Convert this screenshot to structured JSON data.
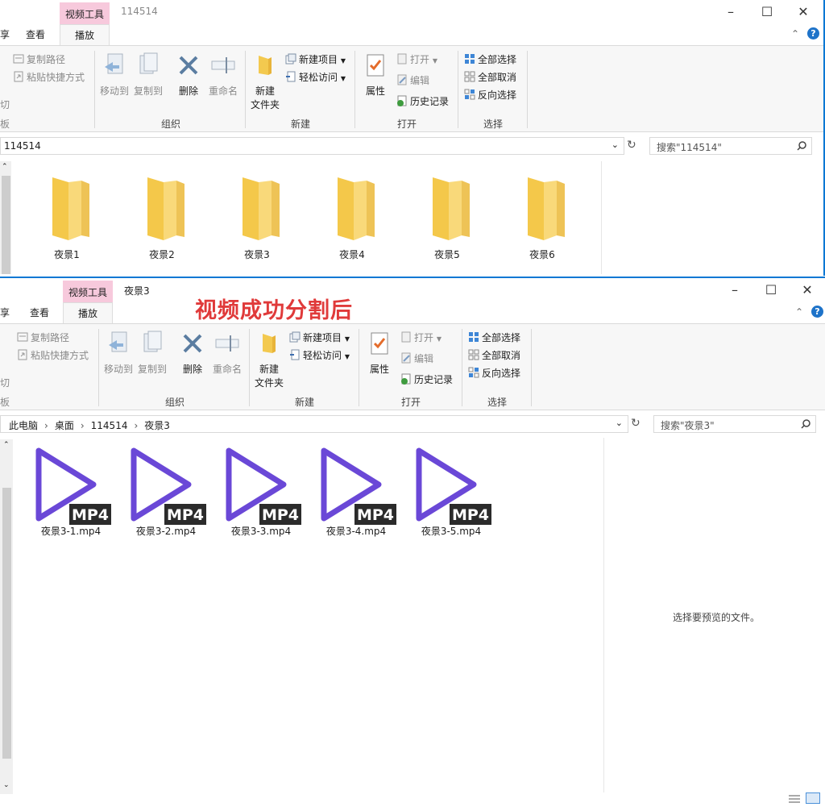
{
  "colors": {
    "accent": "#0a78d4",
    "context_tab": "#f7c9dc",
    "annotation": "#e03a3a",
    "folder": "#f3d068",
    "mp4_purple": "#6a48d7"
  },
  "window1": {
    "context_tab": "视频工具",
    "title": "114514",
    "tabs": {
      "share": "享",
      "view": "查看",
      "play": "播放"
    },
    "clipboard": {
      "copy_path": "复制路径",
      "paste_shortcut": "粘贴快捷方式",
      "cut": "切",
      "group": "板"
    },
    "organize": {
      "move_to": "移动到",
      "copy_to": "复制到",
      "delete": "删除",
      "rename": "重命名",
      "group": "组织"
    },
    "new": {
      "new_folder_1": "新建",
      "new_folder_2": "文件夹",
      "new_item": "新建项目",
      "easy_access": "轻松访问",
      "group": "新建"
    },
    "open": {
      "properties": "属性",
      "open": "打开",
      "edit": "编辑",
      "history": "历史记录",
      "group": "打开"
    },
    "select": {
      "select_all": "全部选择",
      "select_none": "全部取消",
      "invert": "反向选择",
      "group": "选择"
    },
    "address": "114514",
    "search_placeholder": "搜索\"114514\"",
    "folders": [
      "夜景1",
      "夜景2",
      "夜景3",
      "夜景4",
      "夜景5",
      "夜景6"
    ]
  },
  "window2": {
    "context_tab": "视频工具",
    "title": "夜景3",
    "annotation": "视频成功分割后",
    "tabs": {
      "share": "享",
      "view": "查看",
      "play": "播放"
    },
    "clipboard": {
      "copy_path": "复制路径",
      "paste_shortcut": "粘贴快捷方式",
      "cut": "切",
      "group": "板"
    },
    "organize": {
      "move_to": "移动到",
      "copy_to": "复制到",
      "delete": "删除",
      "rename": "重命名",
      "group": "组织"
    },
    "new": {
      "new_folder_1": "新建",
      "new_folder_2": "文件夹",
      "new_item": "新建项目",
      "easy_access": "轻松访问",
      "group": "新建"
    },
    "open": {
      "properties": "属性",
      "open": "打开",
      "edit": "编辑",
      "history": "历史记录",
      "group": "打开"
    },
    "select": {
      "select_all": "全部选择",
      "select_none": "全部取消",
      "invert": "反向选择",
      "group": "选择"
    },
    "breadcrumb": [
      "此电脑",
      "桌面",
      "114514",
      "夜景3"
    ],
    "search_placeholder": "搜索\"夜景3\"",
    "mp4_badge": "MP4",
    "files": [
      "夜景3-1.mp4",
      "夜景3-2.mp4",
      "夜景3-3.mp4",
      "夜景3-4.mp4",
      "夜景3-5.mp4"
    ],
    "preview_message": "选择要预览的文件。"
  }
}
